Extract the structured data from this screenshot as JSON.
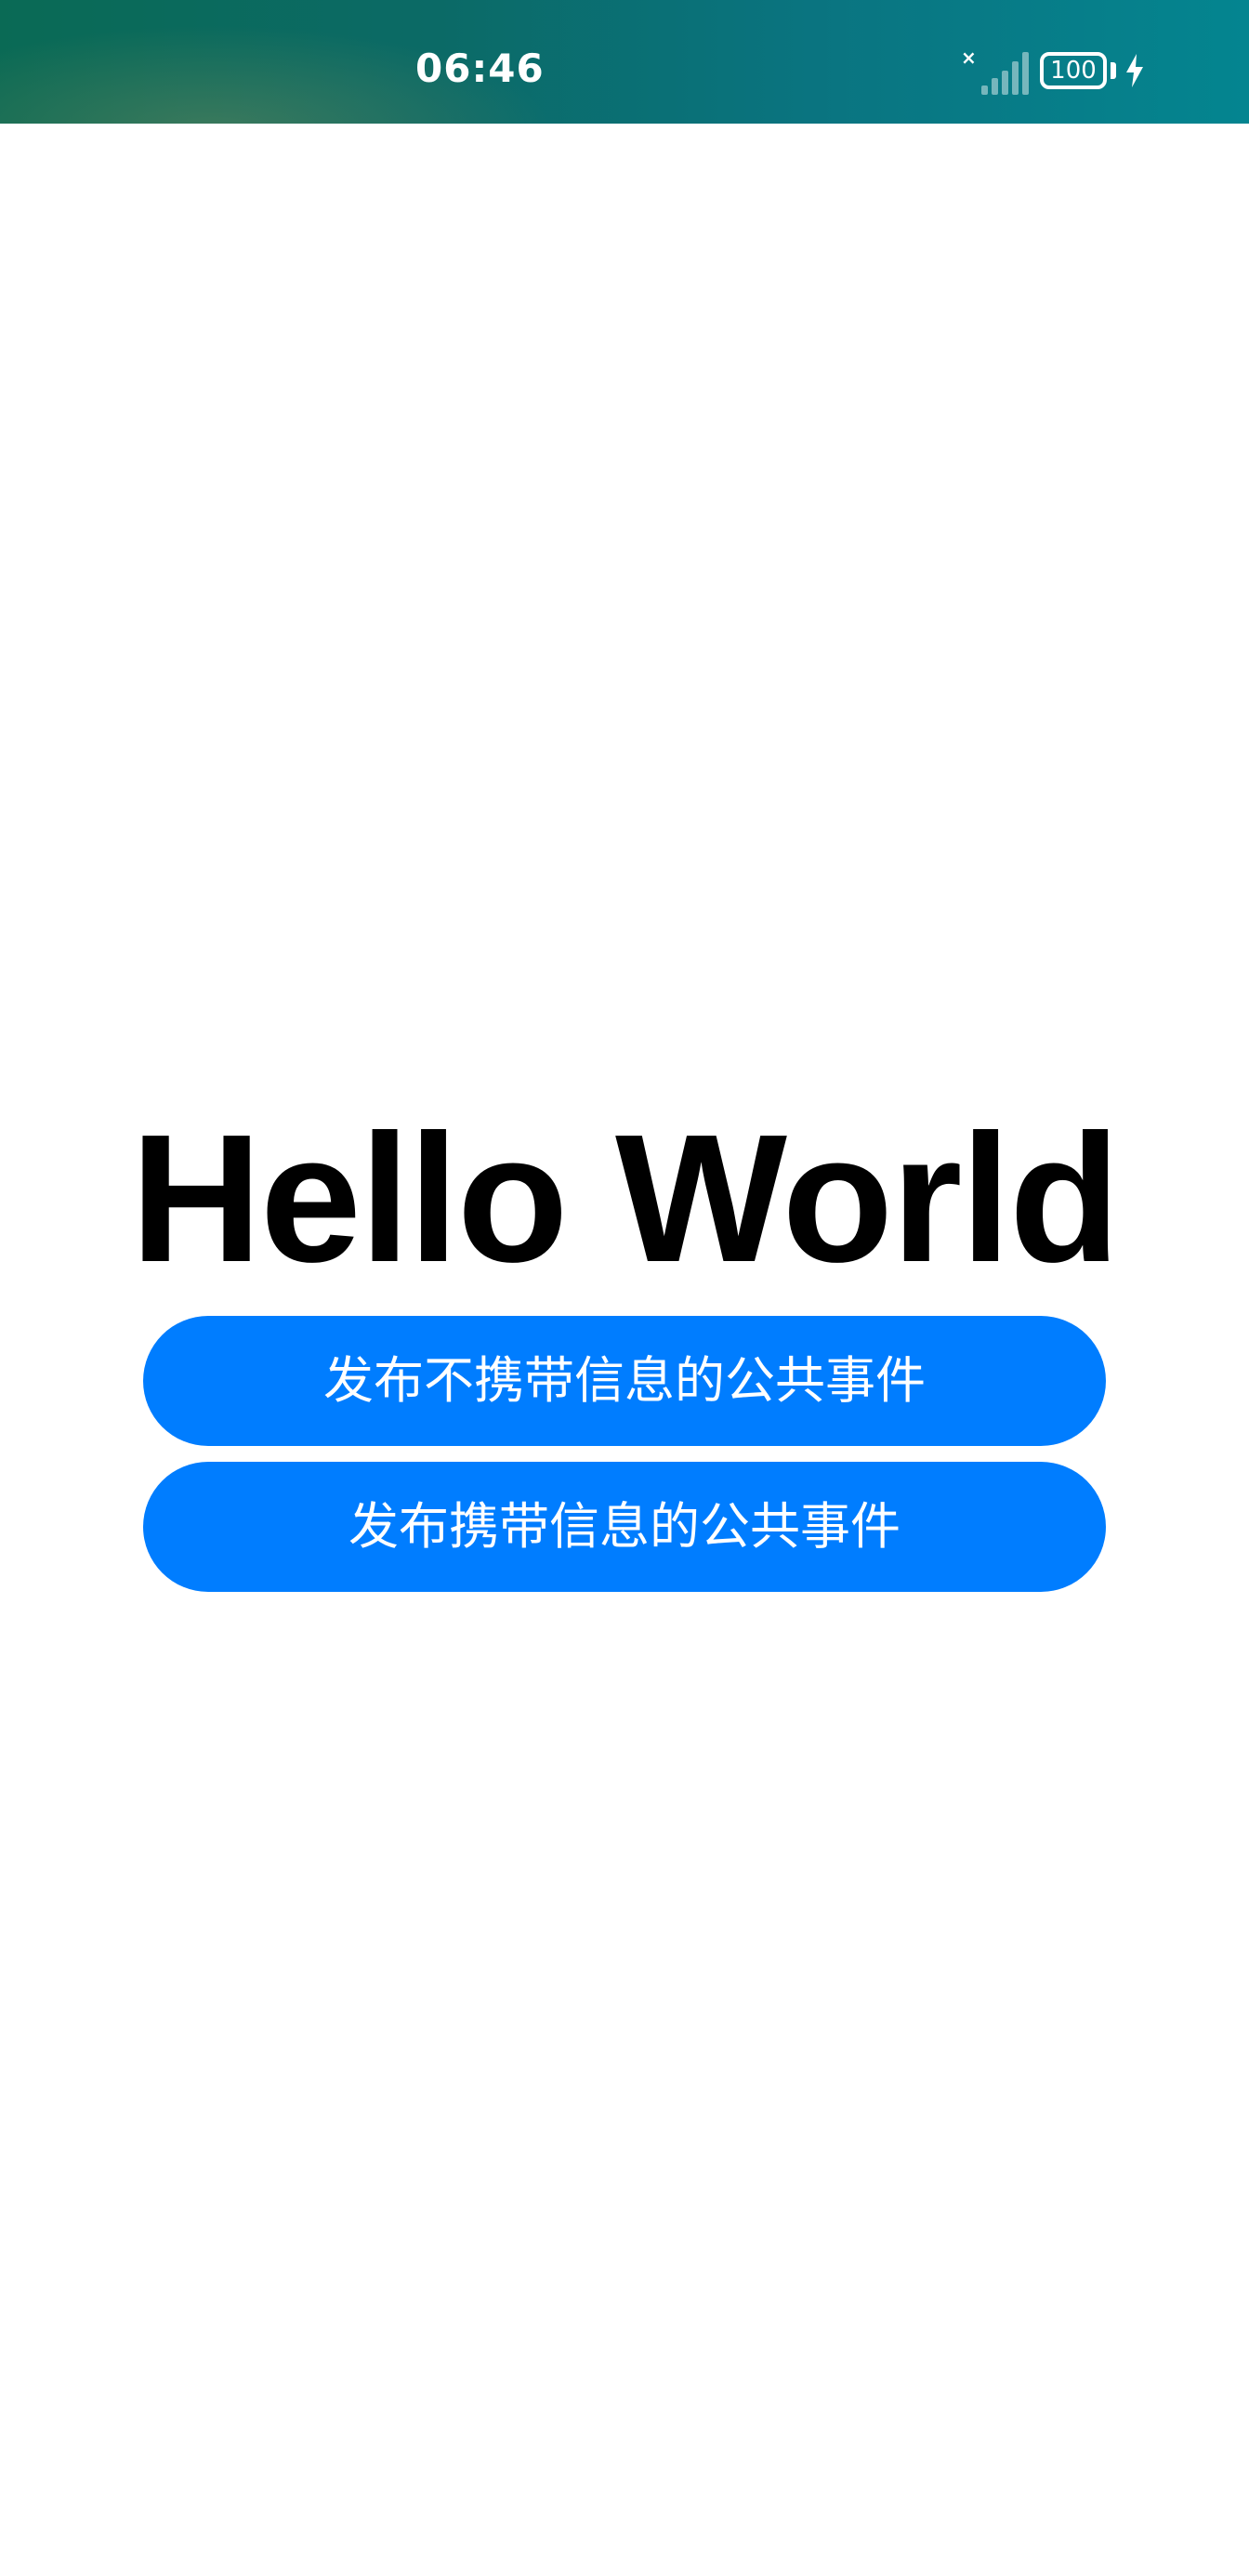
{
  "status_bar": {
    "time": "06:46",
    "battery_level": "100",
    "signal_no_service_mark": "×"
  },
  "content": {
    "title": "Hello World",
    "buttons": [
      {
        "label": "发布不携带信息的公共事件"
      },
      {
        "label": "发布携带信息的公共事件"
      }
    ]
  },
  "colors": {
    "button_background": "#007dff",
    "button_text": "#ffffff",
    "title_text": "#000000",
    "page_background": "#ffffff"
  },
  "icons": [
    "signal-icon",
    "battery-icon",
    "charging-icon"
  ]
}
